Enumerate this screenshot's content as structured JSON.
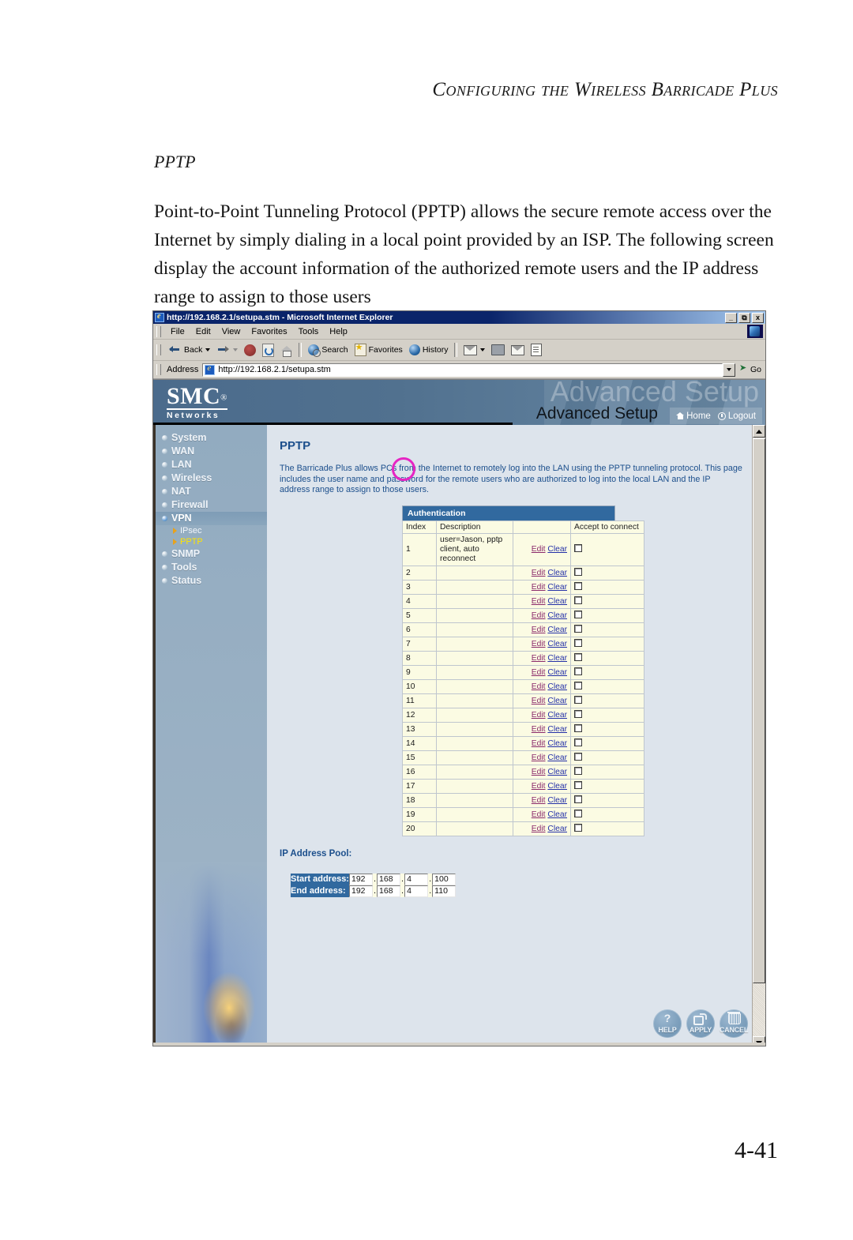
{
  "document": {
    "running_head": "Configuring the Wireless Barricade Plus",
    "section_title": "PPTP",
    "body_paragraph": "Point-to-Point Tunneling Protocol (PPTP) allows the secure remote access over the Internet by simply dialing in a local point provided by an ISP. The following screen display the account information of the authorized remote users and the IP address range to assign to those users",
    "page_number": "4-41"
  },
  "browser": {
    "title": "http://192.168.2.1/setupa.stm - Microsoft Internet Explorer",
    "window_buttons": {
      "minimize": "_",
      "restore": "\u0000",
      "close": "x"
    },
    "menu": [
      "File",
      "Edit",
      "View",
      "Favorites",
      "Tools",
      "Help"
    ],
    "toolbar": {
      "back": "Back",
      "forward": "",
      "stop": "",
      "refresh": "",
      "home": "",
      "search": "Search",
      "favorites": "Favorites",
      "history": "History",
      "mail": "",
      "print": "",
      "edit": "",
      "discuss": ""
    },
    "address": {
      "label": "Address",
      "value": "http://192.168.2.1/setupa.stm",
      "go_label": "Go"
    }
  },
  "banner": {
    "logo_primary": "SMC",
    "logo_reg": "®",
    "logo_secondary": "Networks",
    "ghost_title": "Advanced Setup",
    "title": "Advanced Setup",
    "home_link": "Home",
    "logout_link": "Logout"
  },
  "sidebar": {
    "items": [
      {
        "label": "System",
        "active": false
      },
      {
        "label": "WAN",
        "active": false
      },
      {
        "label": "LAN",
        "active": false
      },
      {
        "label": "Wireless",
        "active": false
      },
      {
        "label": "NAT",
        "active": false
      },
      {
        "label": "Firewall",
        "active": false
      },
      {
        "label": "VPN",
        "active": true
      },
      {
        "label": "SNMP",
        "active": false
      },
      {
        "label": "Tools",
        "active": false
      },
      {
        "label": "Status",
        "active": false
      }
    ],
    "sub_items": [
      {
        "label": "IPsec",
        "selected": false
      },
      {
        "label": "PPTP",
        "selected": true
      }
    ]
  },
  "page": {
    "title": "PPTP",
    "description": "The Barricade Plus allows PCs from the Internet to remotely log into the LAN using the PPTP tunneling protocol.  This page includes the user name and password for the remote users who are authorized to log into the local LAN and the IP address range to assign to those users.",
    "auth_section_title": "Authentication",
    "columns": [
      "Index",
      "Description",
      "",
      "Accept to connect"
    ],
    "edit_label": "Edit",
    "clear_label": "Clear",
    "rows": [
      {
        "index": "1",
        "description": " user=Jason, pptp client, auto reconnect",
        "accept": false
      },
      {
        "index": "2",
        "description": "",
        "accept": false
      },
      {
        "index": "3",
        "description": "",
        "accept": false
      },
      {
        "index": "4",
        "description": "",
        "accept": false
      },
      {
        "index": "5",
        "description": "",
        "accept": false
      },
      {
        "index": "6",
        "description": "",
        "accept": false
      },
      {
        "index": "7",
        "description": "",
        "accept": false
      },
      {
        "index": "8",
        "description": "",
        "accept": false
      },
      {
        "index": "9",
        "description": "",
        "accept": false
      },
      {
        "index": "10",
        "description": "",
        "accept": false
      },
      {
        "index": "11",
        "description": "",
        "accept": false
      },
      {
        "index": "12",
        "description": "",
        "accept": false
      },
      {
        "index": "13",
        "description": "",
        "accept": false
      },
      {
        "index": "14",
        "description": "",
        "accept": false
      },
      {
        "index": "15",
        "description": "",
        "accept": false
      },
      {
        "index": "16",
        "description": "",
        "accept": false
      },
      {
        "index": "17",
        "description": "",
        "accept": false
      },
      {
        "index": "18",
        "description": "",
        "accept": false
      },
      {
        "index": "19",
        "description": "",
        "accept": false
      },
      {
        "index": "20",
        "description": "",
        "accept": false
      }
    ],
    "ip_pool": {
      "title": "IP Address Pool:",
      "start_label": "Start address:",
      "start": [
        "192",
        "168",
        "4",
        "100"
      ],
      "end_label": "End address:",
      "end": [
        "192",
        "168",
        "4",
        "110"
      ]
    },
    "buttons": [
      {
        "caption": "HELP",
        "icon": "question-mark-icon"
      },
      {
        "caption": "APPLY",
        "icon": "plug-icon"
      },
      {
        "caption": "CANCEL",
        "icon": "trash-icon"
      }
    ]
  },
  "colors": {
    "accent_blue": "#31699f",
    "title_blue": "#1c4f8c",
    "highlight_magenta": "#e625c3",
    "table_bg": "#fbfbe3",
    "selected_nav": "#ffe400"
  }
}
